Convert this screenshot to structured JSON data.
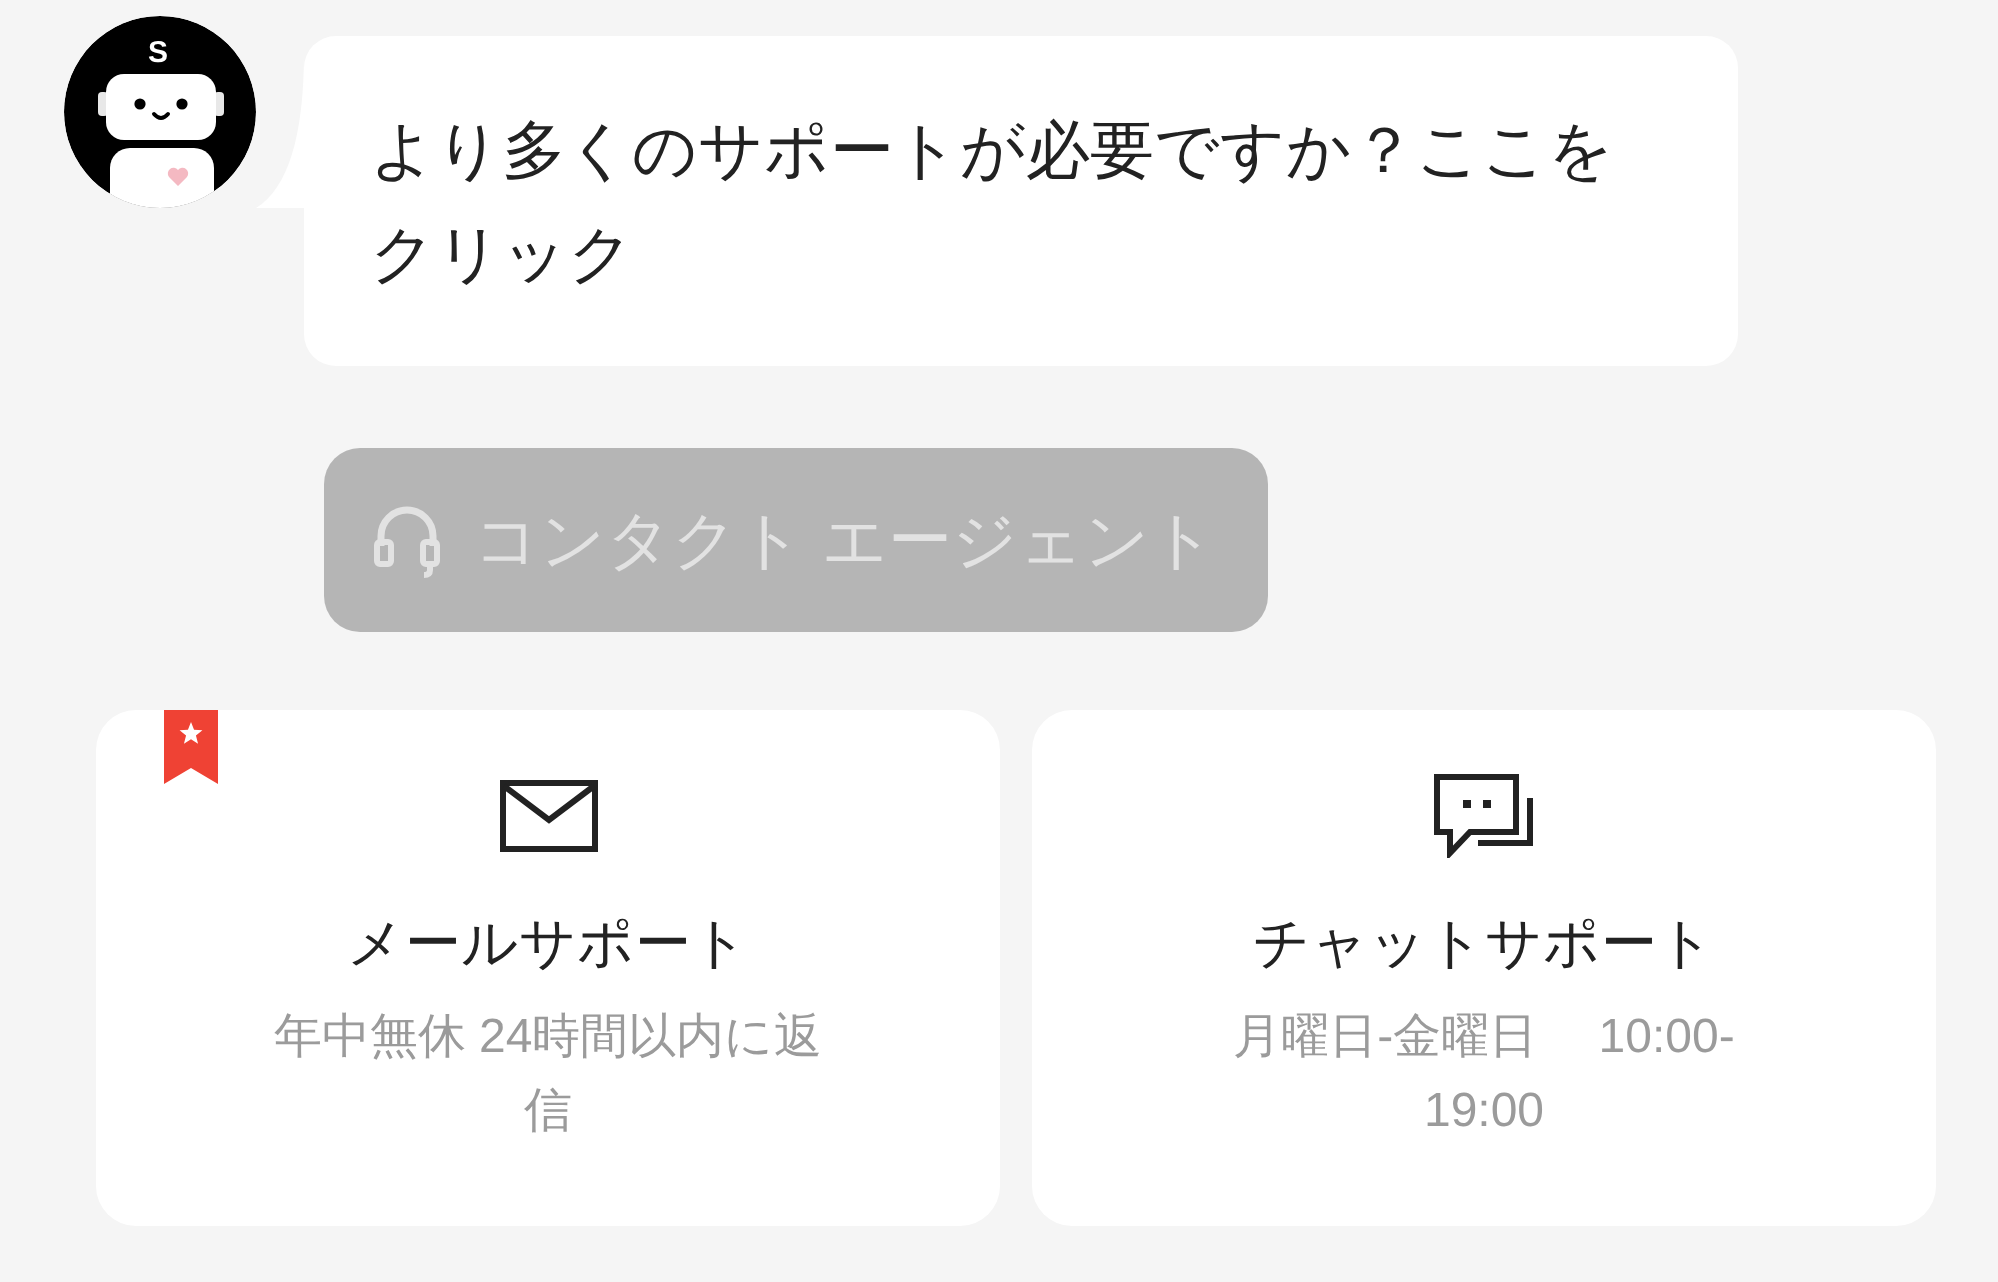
{
  "assistant": {
    "avatar_letter": "S"
  },
  "message": {
    "text": "より多くのサポートが必要ですか？ここをクリック"
  },
  "contact_button": {
    "label": "コンタクト エージェント",
    "disabled": true
  },
  "support_options": [
    {
      "kind": "mail",
      "title": "メールサポート",
      "hours": "年中無休 24時間以内に返信",
      "featured": true
    },
    {
      "kind": "chat",
      "title": "チャットサポート",
      "hours": "月曜日-金曜日　 10:00-19:00",
      "featured": false
    }
  ]
}
